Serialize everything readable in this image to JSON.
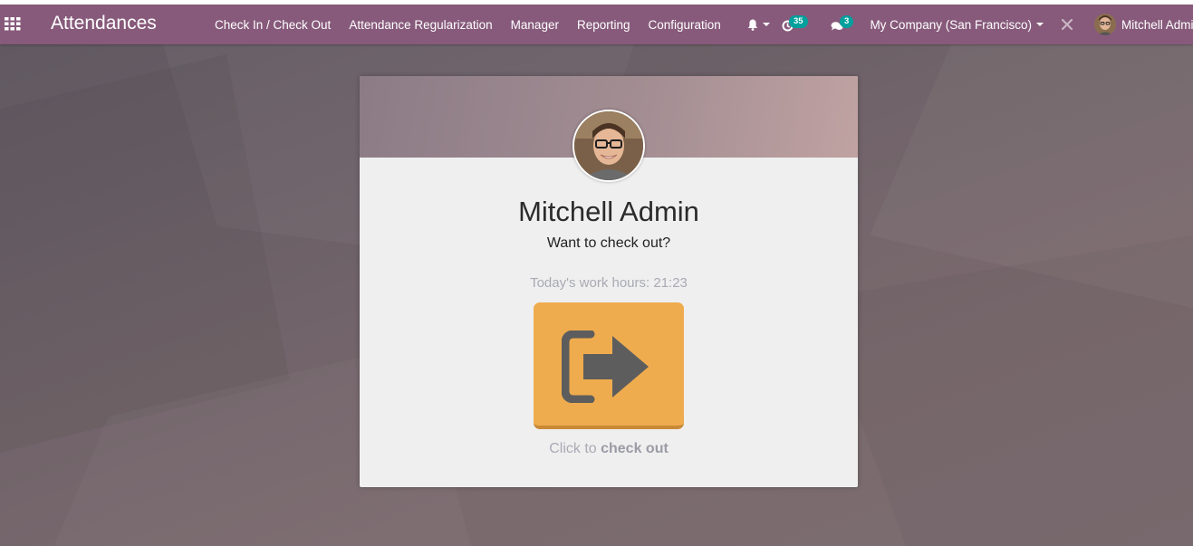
{
  "app": {
    "title": "Attendances"
  },
  "menu": {
    "items": [
      "Check In / Check Out",
      "Attendance Regularization",
      "Manager",
      "Reporting",
      "Configuration"
    ]
  },
  "systray": {
    "activity_count": "35",
    "messages_count": "3",
    "company": "My Company (San Francisco)",
    "user": "Mitchell Admin"
  },
  "kiosk": {
    "employee_name": "Mitchell Admin",
    "question": "Want to check out?",
    "work_hours_label": "Today's work hours: 21:23",
    "click_prefix": "Click to",
    "click_action": "check out"
  },
  "colors": {
    "navbar": "#875a7b",
    "button": "#efac4e",
    "badge": "#00a09d"
  },
  "icons": [
    "apps-grid-icon",
    "bell-icon",
    "clock-activity-icon",
    "chat-bubbles-icon",
    "debug-tools-icon",
    "sign-out-icon"
  ]
}
